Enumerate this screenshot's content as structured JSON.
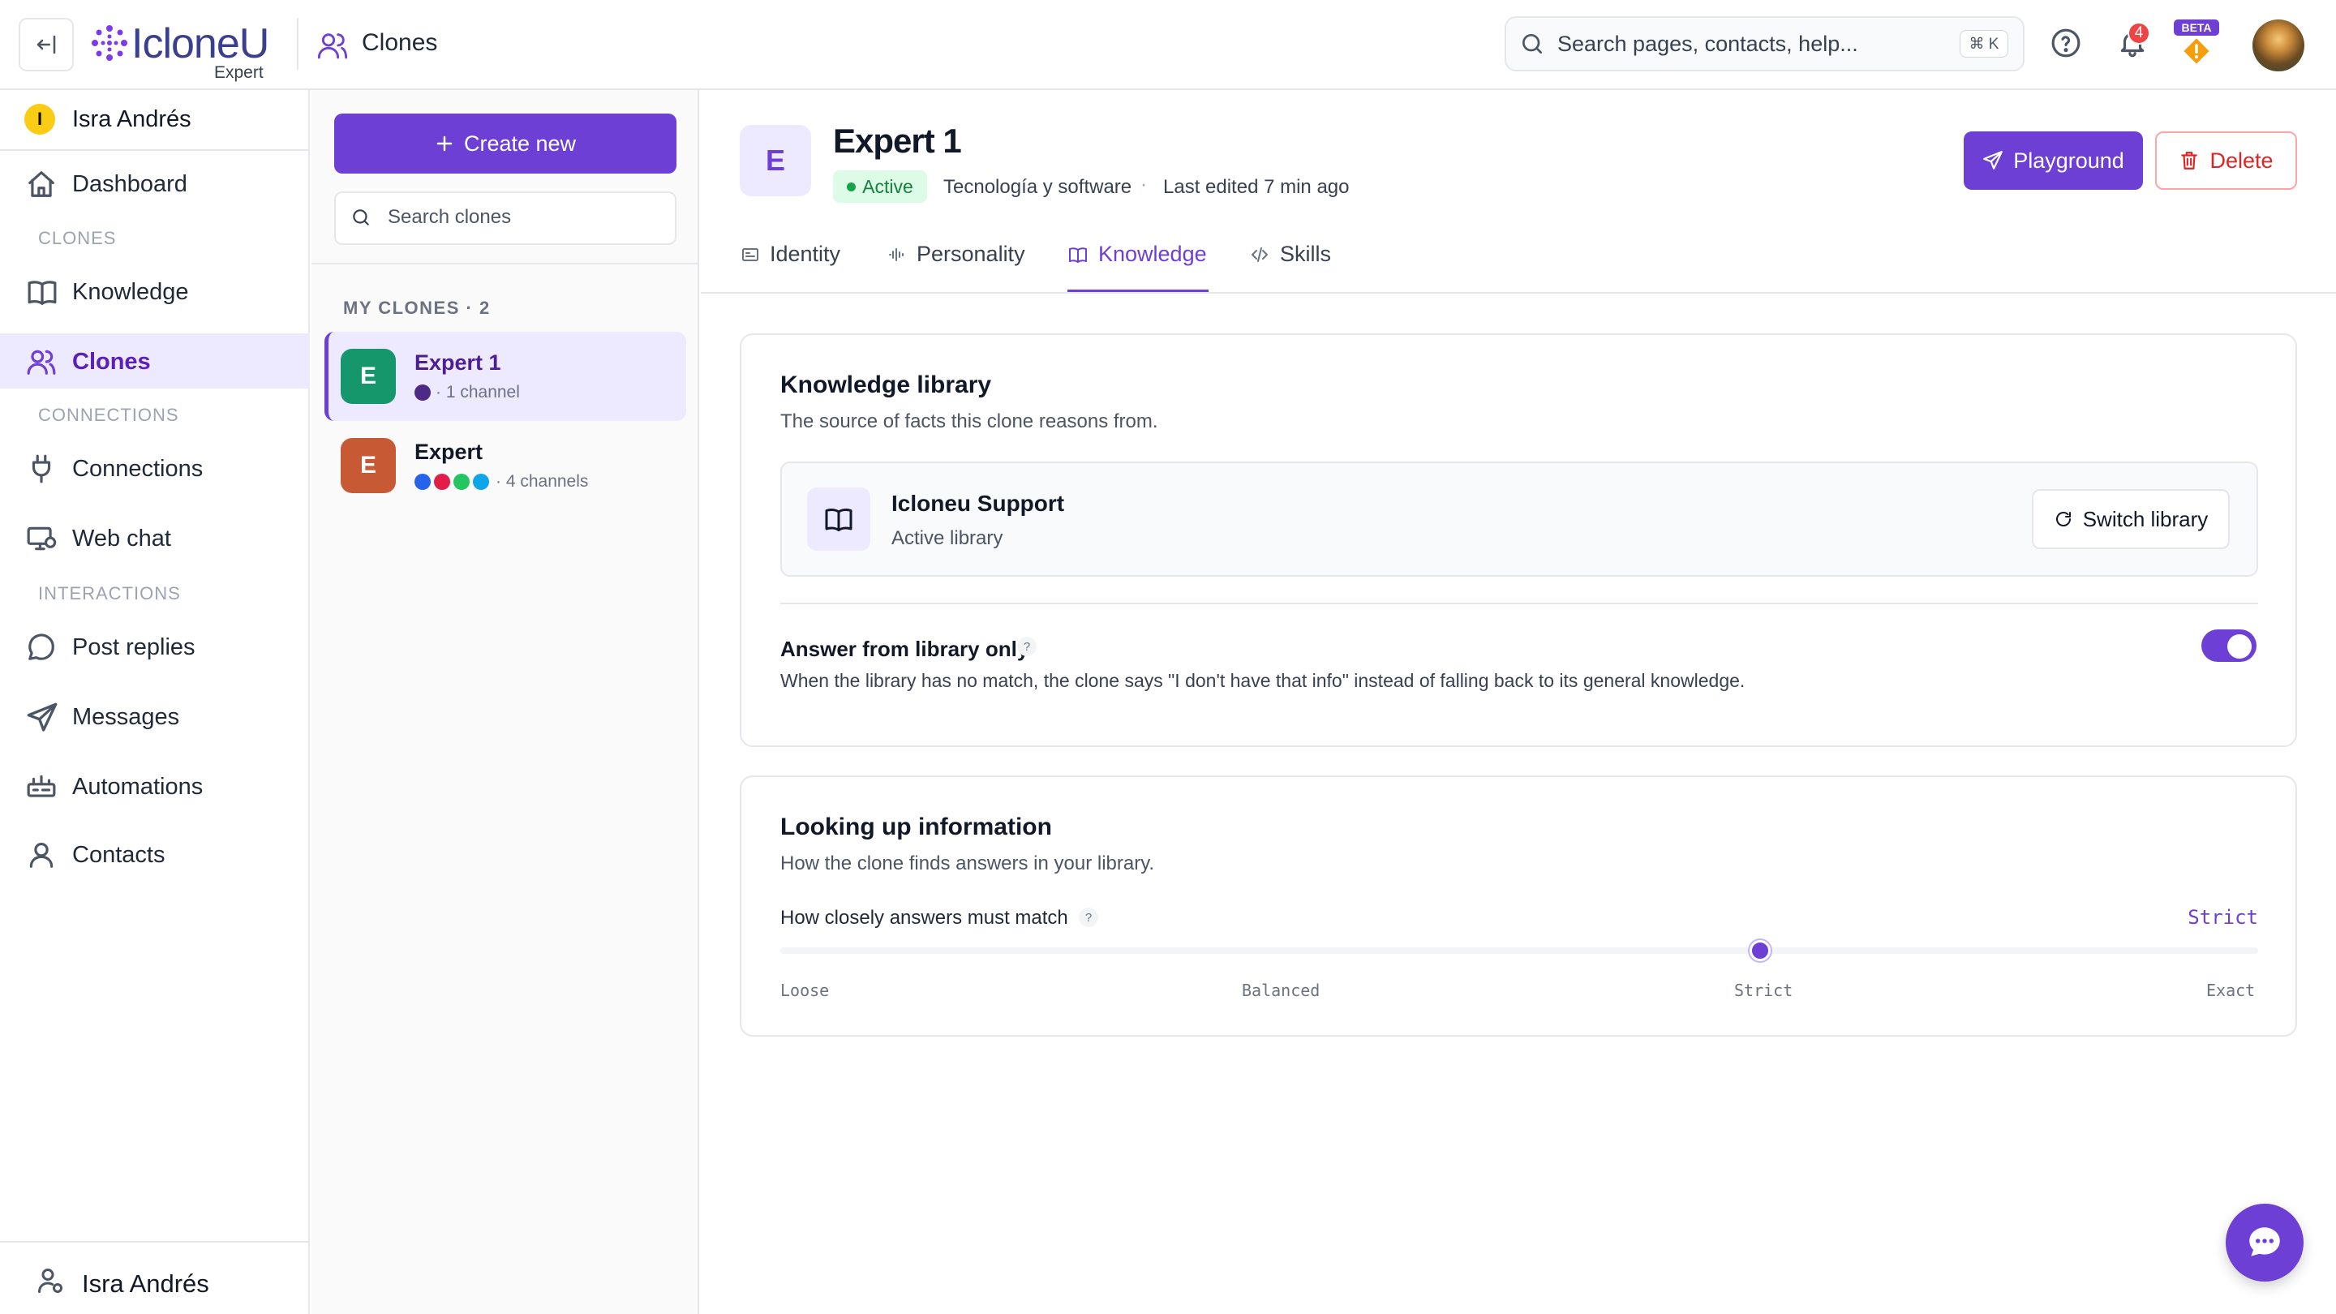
{
  "app": {
    "logo_text": "IcloneU",
    "plan": "Expert"
  },
  "header": {
    "breadcrumb": "Clones",
    "search_placeholder": "Search pages, contacts, help...",
    "search_shortcut": "⌘ K",
    "notification_count": "4",
    "beta_label": "BETA"
  },
  "sidebar": {
    "workspace_initial": "I",
    "workspace_name": "Isra Andrés",
    "dashboard": "Dashboard",
    "section_clones": "CLONES",
    "knowledge": "Knowledge",
    "clones": "Clones",
    "section_connections": "CONNECTIONS",
    "connections": "Connections",
    "web_chat": "Web chat",
    "section_interactions": "INTERACTIONS",
    "post_replies": "Post replies",
    "messages": "Messages",
    "automations": "Automations",
    "contacts": "Contacts",
    "user_name": "Isra Andrés"
  },
  "clones_panel": {
    "create_label": "Create new",
    "search_placeholder": "Search clones",
    "heading": "MY CLONES · 2",
    "items": [
      {
        "initial": "E",
        "name": "Expert 1",
        "channels_text": "· 1 channel",
        "dot_colors": [
          "#4c2a85"
        ],
        "avatar_color": "#15966b",
        "selected": true
      },
      {
        "initial": "E",
        "name": "Expert",
        "channels_text": "· 4 channels",
        "dot_colors": [
          "#2563eb",
          "#e11d48",
          "#22c55e",
          "#0ea5e9"
        ],
        "avatar_color": "#c75a34",
        "selected": false
      }
    ]
  },
  "clone": {
    "initial": "E",
    "name": "Expert 1",
    "status": "Active",
    "category": "Tecnología y software",
    "separator": "·",
    "last_edited": "Last edited 7 min ago",
    "playground_label": "Playground",
    "delete_label": "Delete"
  },
  "tabs": {
    "identity": "Identity",
    "personality": "Personality",
    "knowledge": "Knowledge",
    "skills": "Skills",
    "active": "knowledge"
  },
  "knowledge_library": {
    "title": "Knowledge library",
    "subtitle": "The source of facts this clone reasons from.",
    "library_name": "Icloneu Support",
    "library_status": "Active library",
    "switch_label": "Switch library",
    "library_only_label": "Answer from library only",
    "help_mark": "?",
    "library_only_desc": "When the library has no match, the clone says \"I don't have that info\" instead of falling back to its general knowledge.",
    "library_only_enabled": true
  },
  "lookup": {
    "title": "Looking up information",
    "subtitle": "How the clone finds answers in your library.",
    "match_label": "How closely answers must match",
    "help_mark": "?",
    "current_value": "Strict",
    "level_fraction": 0.663,
    "ticks": [
      "Loose",
      "Balanced",
      "Strict",
      "Exact"
    ]
  },
  "colors": {
    "accent": "#6d3fd4",
    "accent_light": "#ede9fe",
    "danger": "#dc2626",
    "success": "#16a34a"
  }
}
